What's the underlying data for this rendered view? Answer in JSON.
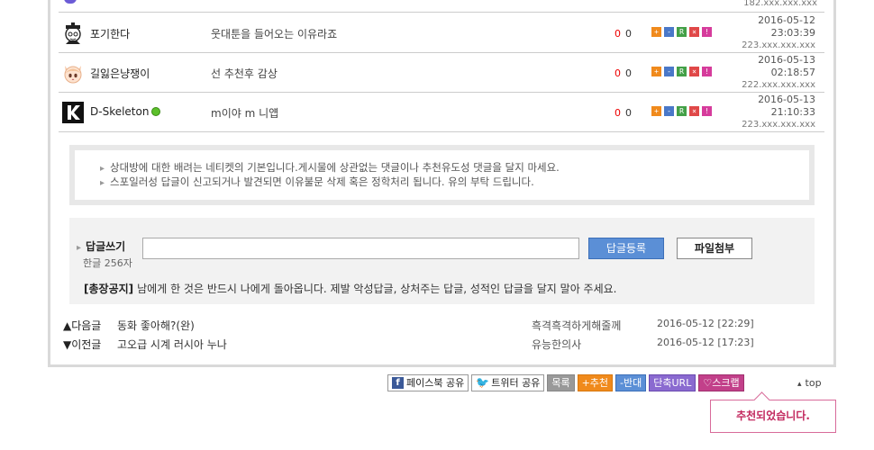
{
  "comments": [
    {
      "nick": "포기한다",
      "text": "웃대툰을 들어오는 이유라죠",
      "up": "0",
      "down": "0",
      "date": "2016-05-12",
      "time": "23:03:39",
      "ip": "223.xxx.xxx.xxx",
      "avatar": "doctor-icon"
    },
    {
      "nick": "길잃은냥쟁이",
      "text": "선 추천후 감상",
      "up": "0",
      "down": "0",
      "date": "2016-05-13",
      "time": "02:18:57",
      "ip": "222.xxx.xxx.xxx",
      "avatar": "anime-girl-icon"
    },
    {
      "nick": "D-Skeleton",
      "text": "m이야 m 니얩",
      "up": "0",
      "down": "0",
      "date": "2016-05-13",
      "time": "21:10:33",
      "ip": "223.xxx.xxx.xxx",
      "avatar": "k-logo-icon",
      "online": true
    }
  ],
  "top_cut_ip": "182.xxx.xxx.xxx",
  "notice": [
    "상대방에 대한 배려는 네티켓의 기본입니다.게시물에 상관없는 댓글이나 추천유도성 댓글을 달지 마세요.",
    "스포일러성 답글이 신고되거나 발견되면 이유불문 삭제 혹은 정학처리 됩니다. 유의 부탁 드립니다."
  ],
  "reply": {
    "label": "답글쓰기",
    "count": "한글 256자",
    "input_value": "",
    "submit": "답글등록",
    "attach": "파일첨부",
    "rule_tag": "[총장공지]",
    "rule_text": "남에게 한 것은 반드시 나에게 돌아옵니다. 제발 악성답글, 상처주는 답글, 성적인 답글을 달지 말아 주세요."
  },
  "nav": [
    {
      "dir": "▲다음글",
      "title": "동화 좋아해?(완)",
      "author": "흑격흑격하게해줄께",
      "date": "2016-05-12 [22:29]"
    },
    {
      "dir": "▼이전글",
      "title": "고오급 시계 러시아 누나",
      "author": "유능한의사",
      "date": "2016-05-12 [17:23]"
    }
  ],
  "buttons": {
    "facebook": "페이스북 공유",
    "twitter": "트위터 공유",
    "list": "목록",
    "recommend": "+추천",
    "oppose": "-반대",
    "shorturl": "단축URL",
    "scrap": "♡스크랩",
    "top": "top"
  },
  "popup": "추천되었습니다.",
  "colors": {
    "accent_blue": "#5b8fd6",
    "recommend_orange": "#f08a1c",
    "vote_red": "#ee0000",
    "popup_pink": "#c2285e"
  }
}
